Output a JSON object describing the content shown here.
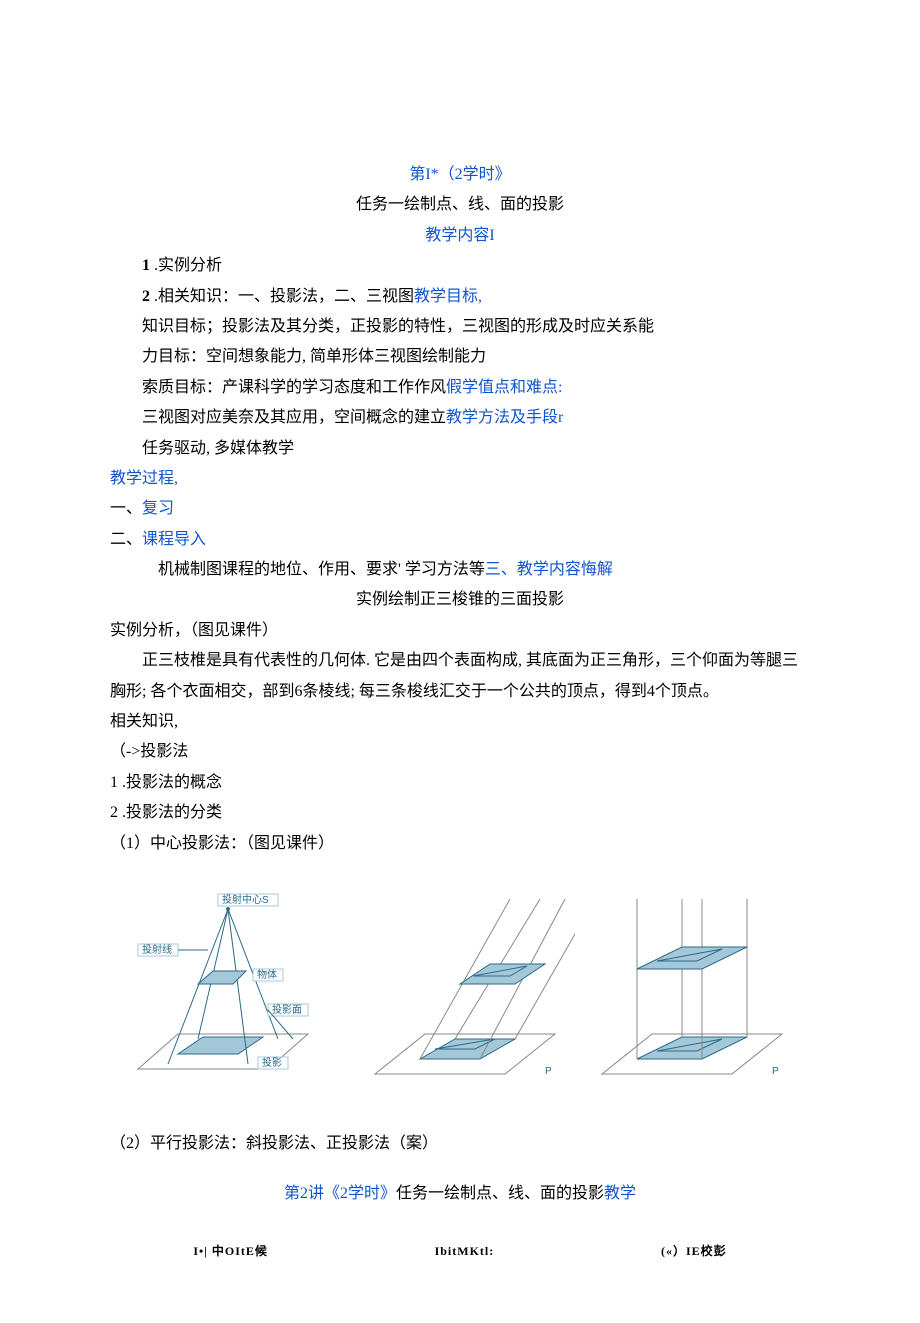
{
  "header_line": "第I*（2学时》",
  "task_title": "任务一绘制点、线、面的投影",
  "section_content": "教学内容I",
  "item1_num": "1",
  "item1_text": " .实例分析",
  "item2_num": "2",
  "item2_text": "   .相关知识：一、投影法，二、三视图",
  "item2_blue": "教学目标,",
  "line_kt": "知识目标；投影法及其分类，正投影的特性，三视图的形成及时应关系能",
  "line_ab": "力目标：空间想象能力, 简单形体三视图绘制能力",
  "line_sz_a": "索质目标：产课科学的学习态度和工作作风",
  "line_sz_blue": "假学值点和难点:",
  "line_sv_a": "三视图对应美奈及其应用，空间概念的建立",
  "line_sv_blue": "教学方法及手段r",
  "line_task": "任务驱动, 多媒体教学",
  "proc": "教学过程,",
  "rev_a": "一、",
  "rev_b": "复习",
  "intro_a": "二、",
  "intro_b": "课程导入",
  "intro_line_a": "机械制图课程的地位、作用、要求' 学习方法等",
  "intro_line_b": "三、教学内容悔解",
  "example_title": "实例绘制正三梭锥的三面投影",
  "ex_analysis": "实例分析，（图见课件）",
  "para1": "正三枝椎是具有代表性的几何体. 它是由四个表面构成, 其底面为正三角形，三个仰面为等腿三胸形; 各个衣面相交，部到6条棱线; 每三条梭线汇交于一个公共的顶点，得到4个顶点。",
  "rel_know": "相关知识,",
  "proj_method": "（->投影法",
  "pm1": "1 .投影法的概念",
  "pm2": "2   .投影法的分类",
  "pm_center": "（1）中心投影法：（图见课件）",
  "svg_labels": {
    "center": "投射中心S",
    "ray": "投射线",
    "obj": "物体",
    "plane": "投影面",
    "shadow": "投影"
  },
  "pm_parallel": "（2）平行投影法：斜投影法、正投影法（案）",
  "lecture2_a": "第2讲《2学时》",
  "lecture2_b": "任务一绘制点、线、面的投影",
  "lecture2_c": "教学",
  "cap1": "I•| 中OItE候",
  "cap2": "IbitMKtl:",
  "cap3": "(«）IE校彭"
}
